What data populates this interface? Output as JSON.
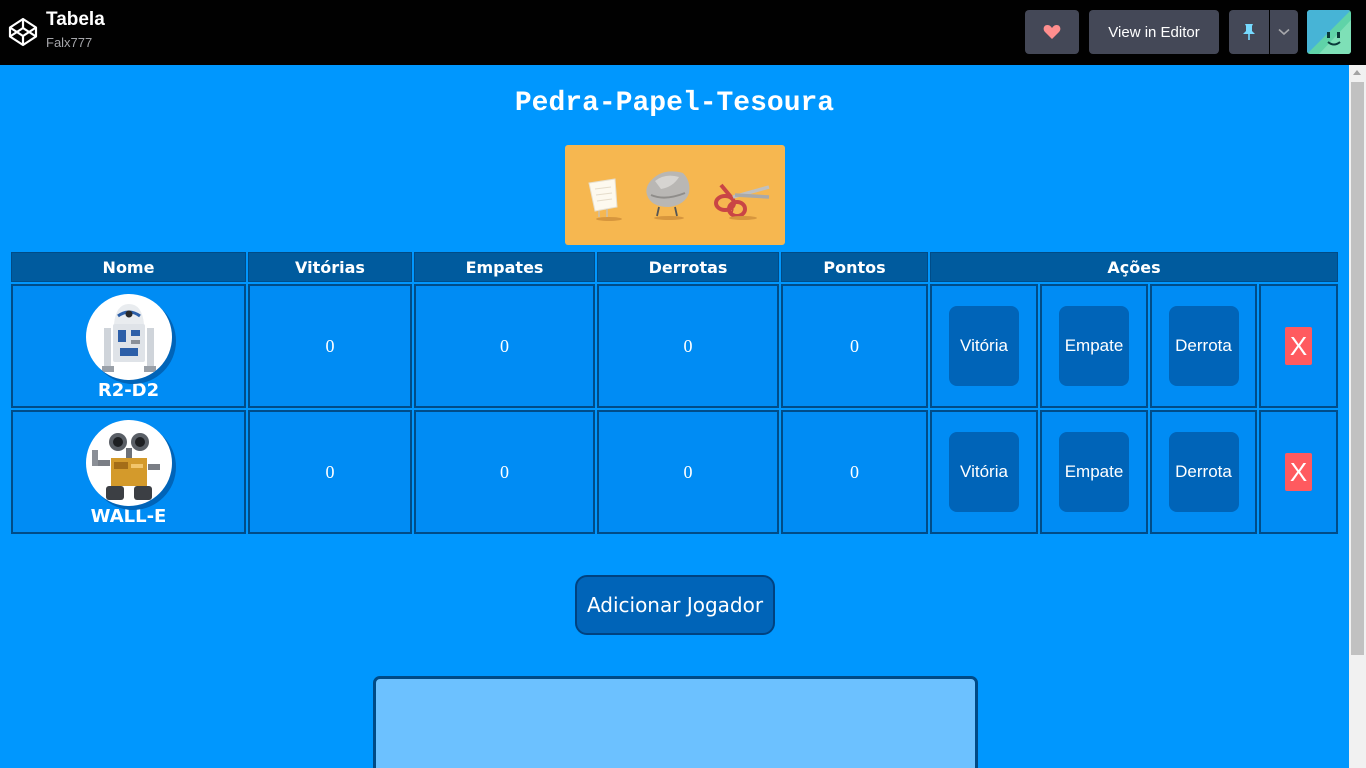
{
  "header": {
    "title": "Tabela",
    "author": "Falx777",
    "view_editor_label": "View in Editor"
  },
  "page": {
    "title": "Pedra-Papel-Tesoura"
  },
  "table": {
    "headers": [
      "Nome",
      "Vitórias",
      "Empates",
      "Derrotas",
      "Pontos",
      "Ações"
    ],
    "rows": [
      {
        "name": "R2-D2",
        "vitorias": "0",
        "empates": "0",
        "derrotas": "0",
        "pontos": "0"
      },
      {
        "name": "WALL-E",
        "vitorias": "0",
        "empates": "0",
        "derrotas": "0",
        "pontos": "0"
      }
    ],
    "actions": {
      "win": "Vitória",
      "draw": "Empate",
      "loss": "Derrota",
      "remove": "X"
    }
  },
  "add_player_label": "Adicionar Jogador",
  "colors": {
    "background": "#0097fe",
    "header_cell": "#005b9e",
    "button": "#0064b8",
    "remove": "#ff5a5f",
    "rps_box": "#f6b750"
  },
  "icons": [
    "codepen-logo-icon",
    "heart-icon",
    "pin-icon",
    "chevron-down-icon"
  ]
}
